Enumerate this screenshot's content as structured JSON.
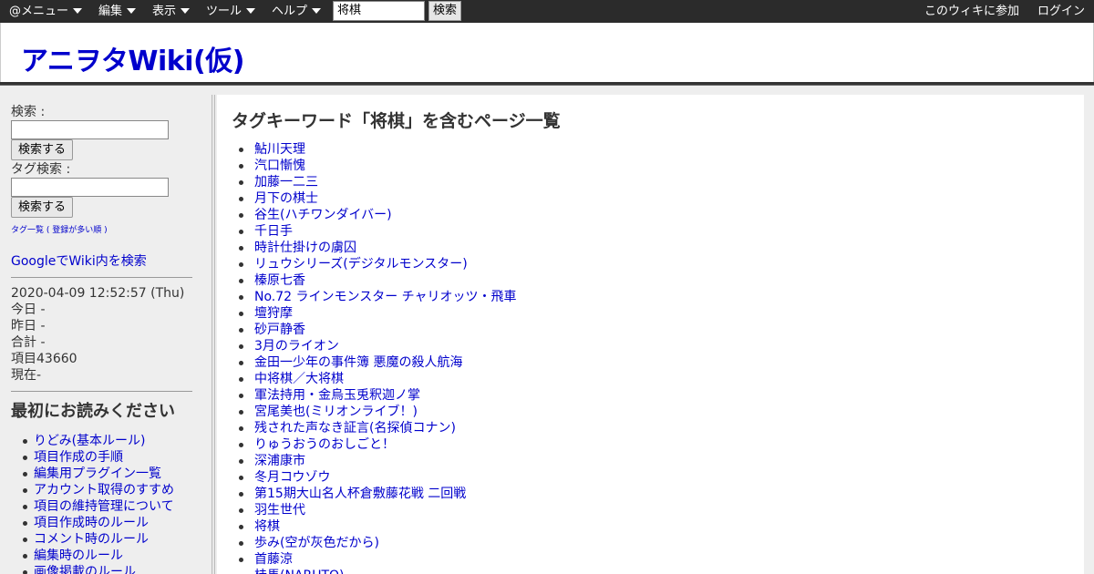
{
  "topbar": {
    "menus": [
      {
        "label": "@メニュー"
      },
      {
        "label": "編集"
      },
      {
        "label": "表示"
      },
      {
        "label": "ツール"
      },
      {
        "label": "ヘルプ"
      }
    ],
    "search_value": "将棋",
    "search_button": "検索",
    "join_link": "このウィキに参加",
    "login_link": "ログイン"
  },
  "header": {
    "site_title": "アニヲタWiki(仮)"
  },
  "sidebar": {
    "search_label": "検索 :",
    "search_button": "検索する",
    "tag_search_label": "タグ検索 :",
    "tag_search_button": "検索する",
    "tag_list_link": "タグ一覧 ( 登録が多い順 )",
    "google_search_link": "GoogleでWiki内を検索",
    "datetime": "2020-04-09 12:52:57 (Thu)",
    "today": "今日 -",
    "yesterday": "昨日 -",
    "total": "合計 -",
    "items_count": "項目43660",
    "online": "現在-",
    "read_first_heading": "最初にお読みください",
    "read_first_items": [
      "りどみ(基本ルール)",
      "項目作成の手順",
      "編集用プラグイン一覧",
      "アカウント取得のすすめ",
      "項目の維持管理について",
      "項目作成時のルール",
      "コメント時のルール",
      "編集時のルール",
      "画像掲載のルール"
    ]
  },
  "main": {
    "title": "タグキーワード「将棋」を含むページ一覧",
    "pages": [
      "鮎川天理",
      "汽口慚愧",
      "加藤一二三",
      "月下の棋士",
      "谷生(ハチワンダイバー)",
      "千日手",
      "時計仕掛けの虜囚",
      "リュウシリーズ(デジタルモンスター)",
      "榛原七香",
      "No.72 ラインモンスター チャリオッツ・飛車",
      "壇狩摩",
      "砂戸静香",
      "3月のライオン",
      "金田一少年の事件簿 悪魔の殺人航海",
      "中将棋／大将棋",
      "軍法持用・金烏玉兎釈迦ノ掌",
      "宮尾美也(ミリオンライブ！)",
      "残された声なき証言(名探偵コナン)",
      "りゅうおうのおしごと！",
      "深浦康市",
      "冬月コウゾウ",
      "第15期大山名人杯倉敷藤花戦 二回戦",
      "羽生世代",
      "将棋",
      "歩み(空が灰色だから)",
      "首藤涼",
      "桂馬(NARUTO)"
    ]
  }
}
